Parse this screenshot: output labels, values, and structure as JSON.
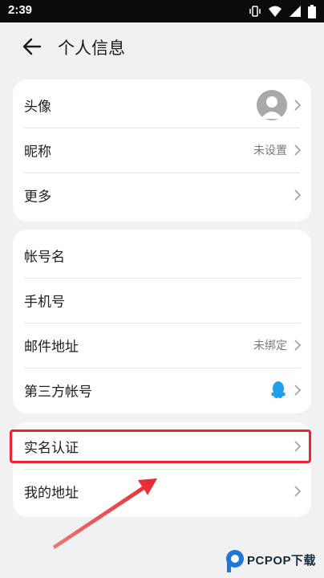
{
  "status_bar": {
    "time": "2:39",
    "icons": [
      "vibrate-icon",
      "wifi-icon",
      "signal-icon",
      "battery-icon"
    ]
  },
  "header": {
    "title": "个人信息",
    "back_icon": "back-arrow-icon"
  },
  "section1": {
    "rows": [
      {
        "label": "头像",
        "value": "",
        "trailing": "avatar"
      },
      {
        "label": "昵称",
        "value": "未设置"
      },
      {
        "label": "更多",
        "value": ""
      }
    ]
  },
  "section2": {
    "rows": [
      {
        "label": "帐号名",
        "value": ""
      },
      {
        "label": "手机号",
        "value": ""
      },
      {
        "label": "邮件地址",
        "value": "未绑定"
      },
      {
        "label": "第三方帐号",
        "value": "",
        "trailing": "qq-icon"
      }
    ]
  },
  "section3": {
    "rows": [
      {
        "label": "实名认证",
        "value": ""
      },
      {
        "label": "我的地址",
        "value": ""
      }
    ]
  },
  "annotation": {
    "highlight_color": "#e8262c"
  },
  "watermark": {
    "text": "PCPOP下载"
  },
  "colors": {
    "background": "#f1f1f3",
    "card": "#ffffff",
    "qq_blue": "#1ea0f0",
    "secondary_text": "#7a7a7a"
  }
}
